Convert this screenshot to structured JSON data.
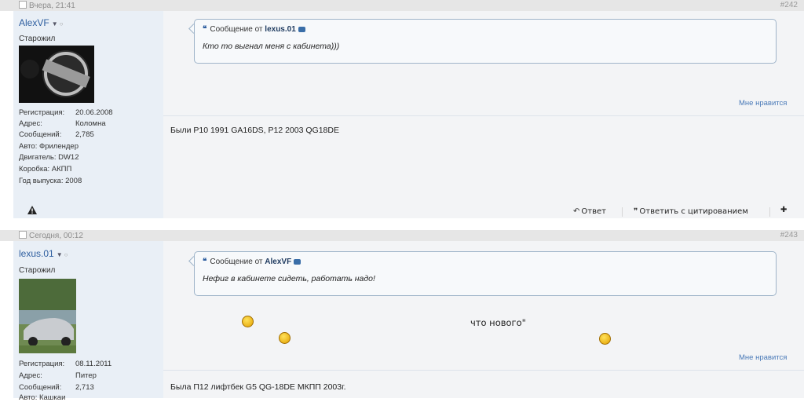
{
  "posts": [
    {
      "date": "Вчера, 21:41",
      "number": "#242",
      "author": {
        "name": "AlexVF",
        "rank": "Старожил",
        "info": [
          {
            "label": "Регистрация:",
            "value": "20.06.2008"
          },
          {
            "label": "Адрес:",
            "value": "Коломна"
          },
          {
            "label": "Сообщений:",
            "value": "2,785"
          },
          {
            "label": "Авто: Фрилендер",
            "value": ""
          },
          {
            "label": "Двигатель: DW12",
            "value": ""
          },
          {
            "label": "Коробка: АКПП",
            "value": ""
          },
          {
            "label": "Год выпуска: 2008",
            "value": ""
          }
        ]
      },
      "quote": {
        "header_prefix": "Сообщение от",
        "author": "lexus.01",
        "text": "Кто то выгнал меня с кабинета)))"
      },
      "like_label": "Мне нравится",
      "body": "Были P10 1991 GA16DS, P12 2003 QG18DE",
      "actions": {
        "reply": "Ответ",
        "reply_quote": "Ответить с цитированием"
      }
    },
    {
      "date": "Сегодня, 00:12",
      "number": "#243",
      "author": {
        "name": "lexus.01",
        "rank": "Старожил",
        "info": [
          {
            "label": "Регистрация:",
            "value": "08.11.2011"
          },
          {
            "label": "Адрес:",
            "value": "Питер"
          },
          {
            "label": "Сообщений:",
            "value": "2,713"
          },
          {
            "label": "Авто: Кашкаи",
            "value": ""
          }
        ]
      },
      "quote": {
        "header_prefix": "Сообщение от",
        "author": "AlexVF",
        "text": "Нефиг в кабинете сидеть, работать надо!"
      },
      "message_text": "что нового\"",
      "like_label": "Мне нравится",
      "body": "Была П12 лифтбек G5 QG-18DE МКПП 2003г."
    }
  ],
  "icons": {
    "warn": "warning-icon",
    "quote": "quote-marks-icon",
    "reply": "reply-arrow-icon",
    "quote_reply": "quote-bubble-icon",
    "multiquote": "multiquote-plus-icon",
    "smiley": "smiley-icon"
  },
  "colors": {
    "link": "#2f5fa0",
    "sidebar_bg": "#e9eff6",
    "post_bg": "#f3f4f6",
    "bar_bg": "#e6e6e6",
    "quote_border": "#9fb4c9"
  }
}
